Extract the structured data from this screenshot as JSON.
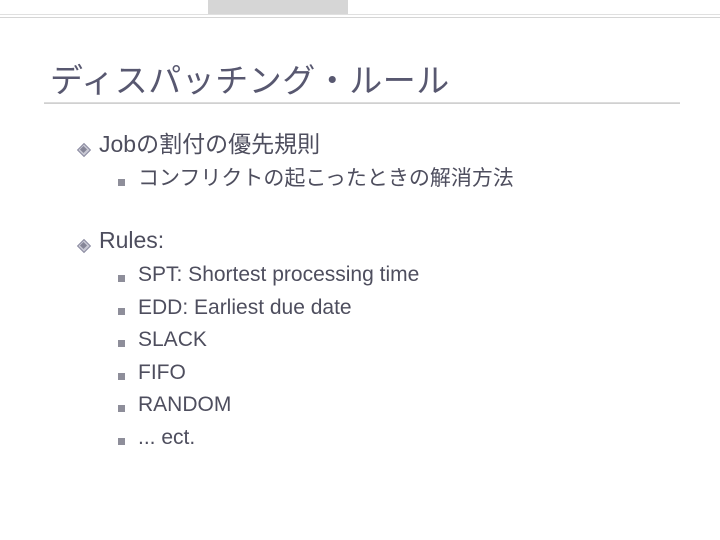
{
  "title": "ディスパッチング・ルール",
  "sections": [
    {
      "heading": "Jobの割付の優先規則",
      "items": [
        "コンフリクトの起こったときの解消方法"
      ]
    },
    {
      "heading": "Rules:",
      "items": [
        "SPT: Shortest processing time",
        "EDD: Earliest due date",
        "SLACK",
        "FIFO",
        "RANDOM",
        "... ect."
      ]
    }
  ]
}
